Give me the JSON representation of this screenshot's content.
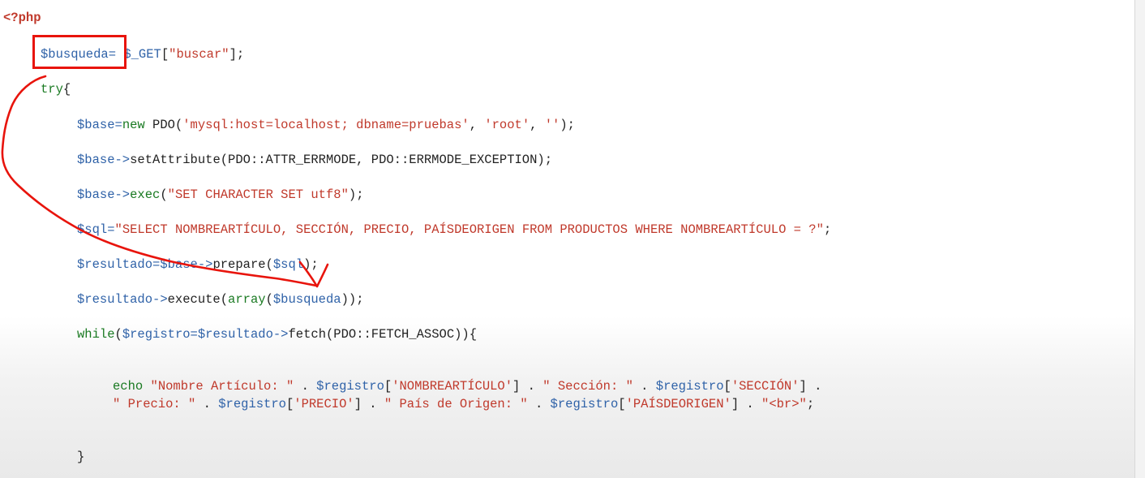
{
  "code_lines": [
    {
      "id": "line-php-open",
      "indent": 0,
      "tokens": [
        {
          "t": "php-tag",
          "v": "<?php"
        }
      ]
    },
    {
      "id": "line-busqueda",
      "indent": 1,
      "tokens": [
        {
          "t": "var",
          "v": "$busqueda"
        },
        {
          "t": "punc",
          "v": "= "
        },
        {
          "t": "var",
          "v": "$_GET"
        },
        {
          "t": "plain",
          "v": "["
        },
        {
          "t": "str",
          "v": "\"buscar\""
        },
        {
          "t": "plain",
          "v": "];"
        }
      ]
    },
    {
      "id": "line-try",
      "indent": 1,
      "tokens": [
        {
          "t": "kw",
          "v": "try"
        },
        {
          "t": "plain",
          "v": "{"
        }
      ]
    },
    {
      "id": "line-base-new",
      "indent": 2,
      "tokens": [
        {
          "t": "var",
          "v": "$base"
        },
        {
          "t": "punc",
          "v": "="
        },
        {
          "t": "kw",
          "v": "new"
        },
        {
          "t": "plain",
          "v": " PDO("
        },
        {
          "t": "str",
          "v": "'mysql:host=localhost; dbname=pruebas'"
        },
        {
          "t": "plain",
          "v": ", "
        },
        {
          "t": "str",
          "v": "'root'"
        },
        {
          "t": "plain",
          "v": ", "
        },
        {
          "t": "str",
          "v": "''"
        },
        {
          "t": "plain",
          "v": ");"
        }
      ]
    },
    {
      "id": "line-setattribute",
      "indent": 2,
      "tokens": [
        {
          "t": "var",
          "v": "$base->"
        },
        {
          "t": "plain",
          "v": "setAttribute(PDO::ATTR_ERRMODE, PDO::ERRMODE_EXCEPTION);"
        }
      ]
    },
    {
      "id": "line-exec",
      "indent": 2,
      "tokens": [
        {
          "t": "var",
          "v": "$base->"
        },
        {
          "t": "kw",
          "v": "exec"
        },
        {
          "t": "plain",
          "v": "("
        },
        {
          "t": "str",
          "v": "\"SET CHARACTER SET utf8\""
        },
        {
          "t": "plain",
          "v": ");"
        }
      ]
    },
    {
      "id": "line-sql",
      "indent": 2,
      "tokens": [
        {
          "t": "var",
          "v": "$sql"
        },
        {
          "t": "punc",
          "v": "="
        },
        {
          "t": "str",
          "v": "\"SELECT NOMBREARTÍCULO, SECCIÓN, PRECIO, PAÍSDEORIGEN FROM PRODUCTOS WHERE NOMBREARTÍCULO = ?\""
        },
        {
          "t": "plain",
          "v": ";"
        }
      ]
    },
    {
      "id": "line-prepare",
      "indent": 2,
      "tokens": [
        {
          "t": "var",
          "v": "$resultado"
        },
        {
          "t": "punc",
          "v": "="
        },
        {
          "t": "var",
          "v": "$base->"
        },
        {
          "t": "plain",
          "v": "prepare("
        },
        {
          "t": "var",
          "v": "$sql"
        },
        {
          "t": "plain",
          "v": ");"
        }
      ]
    },
    {
      "id": "line-execute",
      "indent": 2,
      "tokens": [
        {
          "t": "var",
          "v": "$resultado->"
        },
        {
          "t": "plain",
          "v": "execute("
        },
        {
          "t": "kw",
          "v": "array"
        },
        {
          "t": "plain",
          "v": "("
        },
        {
          "t": "var",
          "v": "$busqueda"
        },
        {
          "t": "plain",
          "v": "));"
        }
      ]
    },
    {
      "id": "line-while",
      "indent": 2,
      "tokens": [
        {
          "t": "kw",
          "v": "while"
        },
        {
          "t": "plain",
          "v": "("
        },
        {
          "t": "var",
          "v": "$registro"
        },
        {
          "t": "punc",
          "v": "="
        },
        {
          "t": "var",
          "v": "$resultado->"
        },
        {
          "t": "plain",
          "v": "fetch(PDO::FETCH_ASSOC)){"
        }
      ]
    },
    {
      "id": "line-echo-1",
      "indent": 3,
      "tokens": [
        {
          "t": "kw",
          "v": "echo"
        },
        {
          "t": "plain",
          "v": " "
        },
        {
          "t": "str",
          "v": "\"Nombre Artículo: \""
        },
        {
          "t": "plain",
          "v": " . "
        },
        {
          "t": "var",
          "v": "$registro"
        },
        {
          "t": "plain",
          "v": "["
        },
        {
          "t": "str",
          "v": "'NOMBREARTÍCULO'"
        },
        {
          "t": "plain",
          "v": "] . "
        },
        {
          "t": "str",
          "v": "\" Sección: \""
        },
        {
          "t": "plain",
          "v": " . "
        },
        {
          "t": "var",
          "v": "$registro"
        },
        {
          "t": "plain",
          "v": "["
        },
        {
          "t": "str",
          "v": "'SECCIÓN'"
        },
        {
          "t": "plain",
          "v": "] ."
        }
      ]
    },
    {
      "id": "line-echo-2",
      "indent": 3,
      "tokens": [
        {
          "t": "str",
          "v": "\" Precio: \""
        },
        {
          "t": "plain",
          "v": " . "
        },
        {
          "t": "var",
          "v": "$registro"
        },
        {
          "t": "plain",
          "v": "["
        },
        {
          "t": "str",
          "v": "'PRECIO'"
        },
        {
          "t": "plain",
          "v": "] . "
        },
        {
          "t": "str",
          "v": "\" País de Origen: \""
        },
        {
          "t": "plain",
          "v": " . "
        },
        {
          "t": "var",
          "v": "$registro"
        },
        {
          "t": "plain",
          "v": "["
        },
        {
          "t": "str",
          "v": "'PAÍSDEORIGEN'"
        },
        {
          "t": "plain",
          "v": "] . "
        },
        {
          "t": "str",
          "v": "\"<br>\""
        },
        {
          "t": "plain",
          "v": ";"
        }
      ]
    },
    {
      "id": "line-close-brace",
      "indent": 2,
      "tokens": [
        {
          "t": "plain",
          "v": "}"
        }
      ]
    }
  ],
  "colors": {
    "variable": "#2f62a8",
    "keyword": "#1a7a22",
    "string": "#c0392b",
    "plain": "#222222",
    "annotation": "#e8140c"
  }
}
